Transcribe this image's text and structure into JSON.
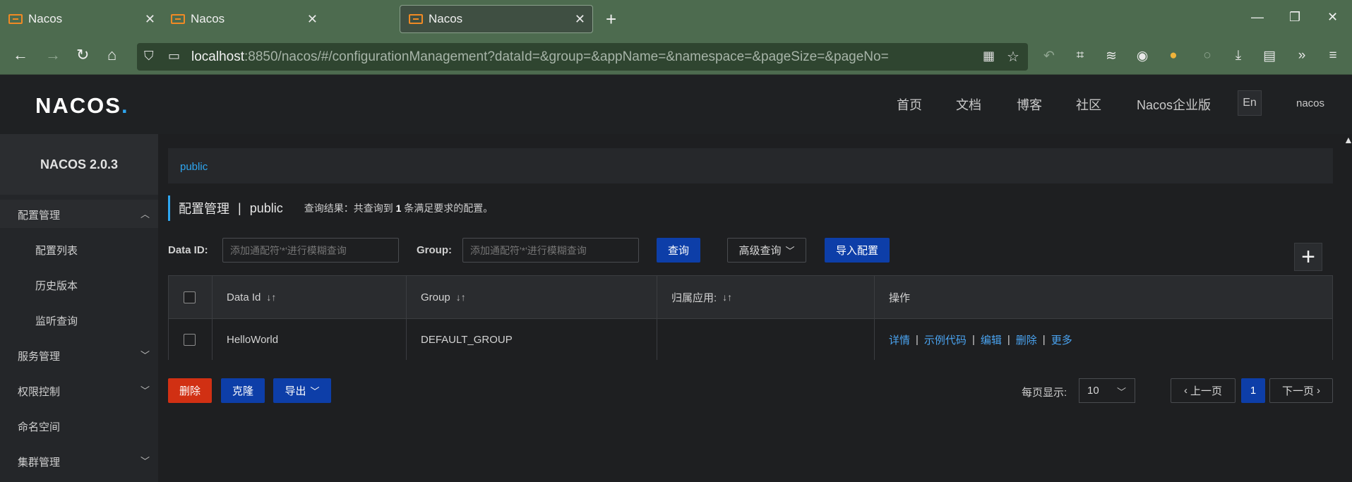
{
  "browser": {
    "tabs": [
      {
        "title": "Nacos",
        "active": false
      },
      {
        "title": "Nacos",
        "active": false
      },
      {
        "title": "Nacos",
        "active": true
      }
    ],
    "new_tab": "+",
    "url_host": "localhost",
    "url_rest": ":8850/nacos/#/configurationManagement?dataId=&group=&appName=&namespace=&pageSize=&pageNo="
  },
  "header": {
    "logo": "NACOS",
    "logo_dot": ".",
    "nav": [
      "首页",
      "文档",
      "博客",
      "社区",
      "Nacos企业版"
    ],
    "lang": "En",
    "user": "nacos"
  },
  "sidebar": {
    "title": "NACOS 2.0.3",
    "items": [
      {
        "label": "配置管理",
        "chevron": "up"
      },
      {
        "label": "配置列表"
      },
      {
        "label": "历史版本"
      },
      {
        "label": "监听查询"
      },
      {
        "label": "服务管理",
        "chevron": "down"
      },
      {
        "label": "权限控制",
        "chevron": "down"
      },
      {
        "label": "命名空间"
      },
      {
        "label": "集群管理",
        "chevron": "down"
      }
    ]
  },
  "main": {
    "namespace_tab": "public",
    "title": "配置管理",
    "title_sep": "|",
    "namespace": "public",
    "result_prefix": "查询结果：共查询到",
    "result_count": "1",
    "result_suffix": "条满足要求的配置。",
    "filters": {
      "dataid_label": "Data ID:",
      "dataid_placeholder": "添加通配符'*'进行模糊查询",
      "group_label": "Group:",
      "group_placeholder": "添加通配符'*'进行模糊查询",
      "query_btn": "查询",
      "advanced_btn": "高级查询",
      "import_btn": "导入配置",
      "add_btn": "+"
    },
    "table": {
      "headers": [
        "Data Id",
        "Group",
        "归属应用:",
        "操作"
      ],
      "sort_glyph": "↓↑",
      "rows": [
        {
          "data_id": "HelloWorld",
          "group": "DEFAULT_GROUP",
          "app": "",
          "actions": [
            "详情",
            "示例代码",
            "编辑",
            "删除",
            "更多"
          ]
        }
      ]
    },
    "bulk": {
      "delete_btn": "删除",
      "clone_btn": "克隆",
      "export_btn": "导出"
    },
    "pagination": {
      "label": "每页显示:",
      "page_size": "10",
      "prev": "上一页",
      "current": "1",
      "next": "下一页"
    }
  },
  "colors": {
    "accent": "#2ea6f0",
    "primary": "#0d3ea8",
    "danger": "#d13013",
    "link": "#4aa3f0",
    "chrome": "#4d6b4f"
  }
}
